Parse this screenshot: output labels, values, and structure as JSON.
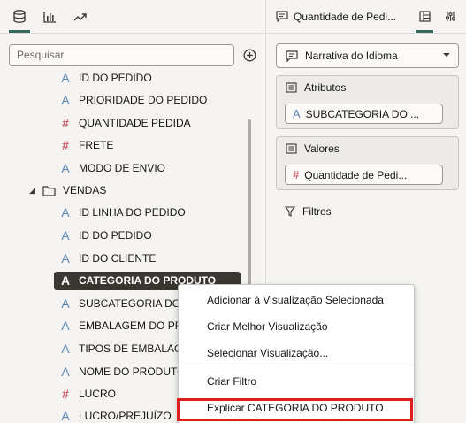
{
  "left_panel": {
    "tabs": [
      {
        "name": "data-icon"
      },
      {
        "name": "visualizations-icon"
      },
      {
        "name": "analytics-icon"
      }
    ],
    "search_placeholder": "Pesquisar",
    "tree": [
      {
        "type": "text",
        "label": "ID DO PEDIDO"
      },
      {
        "type": "text",
        "label": "PRIORIDADE DO PEDIDO"
      },
      {
        "type": "number",
        "label": "QUANTIDADE PEDIDA"
      },
      {
        "type": "number",
        "label": "FRETE"
      },
      {
        "type": "text",
        "label": "MODO DE ENVIO"
      },
      {
        "type": "folder",
        "label": "VENDAS"
      },
      {
        "type": "text",
        "label": "ID LINHA DO PEDIDO"
      },
      {
        "type": "text",
        "label": "ID DO PEDIDO"
      },
      {
        "type": "text",
        "label": "ID DO CLIENTE"
      },
      {
        "type": "text",
        "label": "CATEGORIA DO PRODUTO",
        "selected": true
      },
      {
        "type": "text",
        "label": "SUBCATEGORIA DO"
      },
      {
        "type": "text",
        "label": "EMBALAGEM DO PR"
      },
      {
        "type": "text",
        "label": "TIPOS DE EMBALAG"
      },
      {
        "type": "text",
        "label": "NOME DO PRODUTO"
      },
      {
        "type": "number",
        "label": "LUCRO"
      },
      {
        "type": "text",
        "label": "LUCRO/PREJUÍZO"
      }
    ]
  },
  "right_panel": {
    "tab_title": "Quantidade de Pedi...",
    "viz_type": "Narrativa do Idioma",
    "attributes": {
      "title": "Atributos",
      "chip": "SUBCATEGORIA DO ..."
    },
    "values": {
      "title": "Valores",
      "chip": "Quantidade de Pedi..."
    },
    "filters": "Filtros"
  },
  "context_menu": {
    "items": [
      "Adicionar à Visualização Selecionada",
      "Criar Melhor Visualização",
      "Selecionar Visualização...",
      "Criar Filtro",
      "Explicar CATEGORIA DO PRODUTO"
    ],
    "highlighted_item": "Explicar CATEGORIA DO PRODUTO",
    "highlight_color": "#e01e1e"
  },
  "colors": {
    "accent": "#35685a",
    "text_type_icon": "#5e86b3",
    "number_type_icon": "#c8626b",
    "selected_bg": "#3a3631"
  }
}
